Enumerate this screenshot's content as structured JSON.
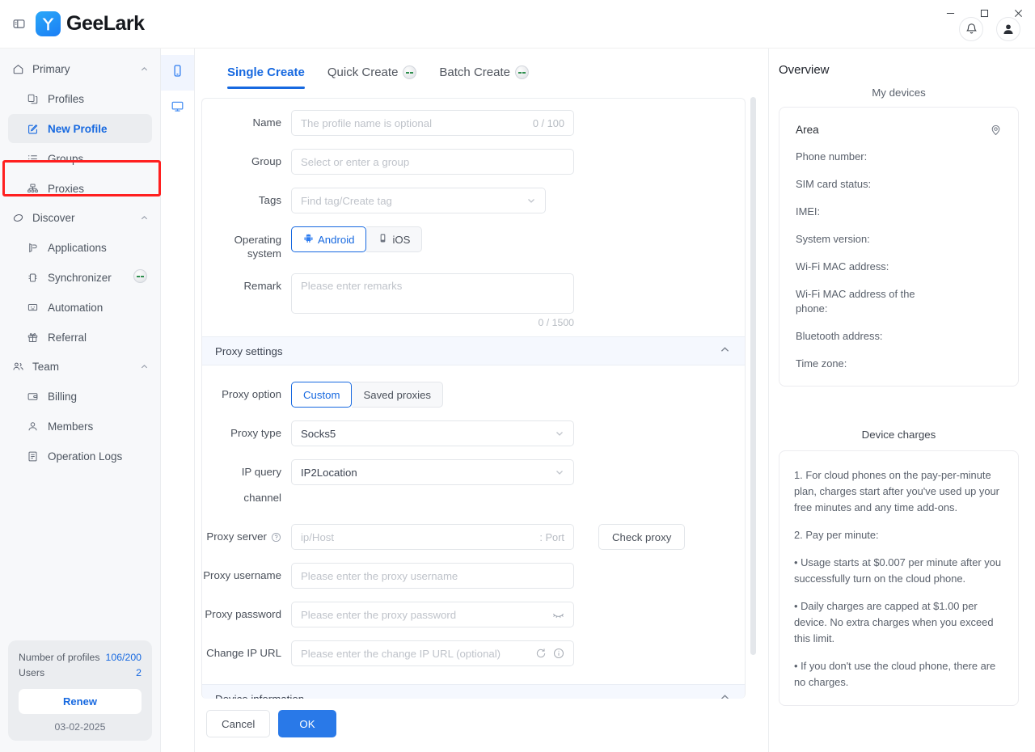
{
  "window": {
    "minimize_label": "Minimize",
    "maximize_label": "Maximize",
    "close_label": "Close"
  },
  "brand": {
    "name": "GeeLark"
  },
  "sidebar": {
    "groups": [
      {
        "label": "Primary",
        "icon": "home-icon",
        "items": [
          {
            "label": "Profiles",
            "icon": "profiles-icon",
            "active": false,
            "badge": false
          },
          {
            "label": "New Profile",
            "icon": "new-profile-icon",
            "active": true,
            "badge": false
          },
          {
            "label": "Groups",
            "icon": "groups-icon",
            "active": false,
            "badge": false
          },
          {
            "label": "Proxies",
            "icon": "proxies-icon",
            "active": false,
            "badge": false
          }
        ]
      },
      {
        "label": "Discover",
        "icon": "discover-icon",
        "items": [
          {
            "label": "Applications",
            "icon": "applications-icon",
            "active": false,
            "badge": false
          },
          {
            "label": "Synchronizer",
            "icon": "synchronizer-icon",
            "active": false,
            "badge": true
          },
          {
            "label": "Automation",
            "icon": "automation-icon",
            "active": false,
            "badge": false
          },
          {
            "label": "Referral",
            "icon": "referral-icon",
            "active": false,
            "badge": false
          }
        ]
      },
      {
        "label": "Team",
        "icon": "team-icon",
        "items": [
          {
            "label": "Billing",
            "icon": "billing-icon",
            "active": false,
            "badge": false
          },
          {
            "label": "Members",
            "icon": "members-icon",
            "active": false,
            "badge": false
          },
          {
            "label": "Operation Logs",
            "icon": "operation-logs-icon",
            "active": false,
            "badge": false
          }
        ]
      }
    ],
    "footer": {
      "profiles_label": "Number of profiles",
      "profiles_value": "106/200",
      "users_label": "Users",
      "users_value": "2",
      "renew_label": "Renew",
      "date": "03-02-2025"
    }
  },
  "rail": {
    "items": [
      {
        "icon": "phone-icon",
        "active": true
      },
      {
        "icon": "desktop-icon",
        "active": false
      }
    ]
  },
  "main": {
    "tabs": [
      {
        "label": "Single Create",
        "active": true,
        "badge": false
      },
      {
        "label": "Quick Create",
        "active": false,
        "badge": true
      },
      {
        "label": "Batch Create",
        "active": false,
        "badge": true
      }
    ],
    "form": {
      "name_label": "Name",
      "name_placeholder": "The profile name is optional",
      "name_counter": "0 / 100",
      "group_label": "Group",
      "group_placeholder": "Select or enter a group",
      "tags_label": "Tags",
      "tags_placeholder": "Find tag/Create tag",
      "os_label": "Operating system",
      "os_options": [
        {
          "label": "Android",
          "selected": true,
          "icon": "android-icon"
        },
        {
          "label": "iOS",
          "selected": false,
          "icon": "ios-icon"
        }
      ],
      "remark_label": "Remark",
      "remark_placeholder": "Please enter remarks",
      "remark_counter": "0 / 1500"
    },
    "proxy_section": {
      "title": "Proxy settings",
      "collapse_icon": "chevron-up-icon",
      "option_label": "Proxy option",
      "options": [
        {
          "label": "Custom",
          "selected": true
        },
        {
          "label": "Saved proxies",
          "selected": false
        }
      ],
      "type_label": "Proxy type",
      "type_value": "Socks5",
      "channel_label": "IP query channel",
      "channel_value": "IP2Location",
      "server_label": "Proxy server",
      "server_help_icon": "question-circle-icon",
      "server_placeholder": "ip/Host",
      "server_port_placeholder": ": Port",
      "check_proxy_label": "Check proxy",
      "username_label": "Proxy username",
      "username_placeholder": "Please enter the proxy username",
      "password_label": "Proxy password",
      "password_placeholder": "Please enter the proxy password",
      "password_toggle_icon": "eye-closed-icon",
      "change_ip_label": "Change IP URL",
      "change_ip_placeholder": "Please enter the change IP URL (optional)",
      "change_ip_refresh_icon": "refresh-icon",
      "change_ip_info_icon": "info-circle-icon"
    },
    "device_section": {
      "title": "Device information",
      "collapse_icon": "chevron-up-icon"
    },
    "footer": {
      "cancel_label": "Cancel",
      "ok_label": "OK"
    }
  },
  "overview": {
    "title": "Overview",
    "devices_subtitle": "My devices",
    "area_label": "Area",
    "location_icon": "location-pin-icon",
    "fields": [
      "Phone number:",
      "SIM card status:",
      "IMEI:",
      "System version:",
      "Wi-Fi MAC address:",
      "Wi-Fi MAC address of the phone:",
      "Bluetooth address:",
      "Time zone:"
    ],
    "charges_title": "Device charges",
    "charges_paragraphs": [
      "1. For cloud phones on the pay-per-minute plan, charges start after you've used up your free minutes and any time add-ons.",
      "2. Pay per minute:",
      "• Usage starts at $0.007 per minute after you successfully turn on the cloud phone.",
      "• Daily charges are capped at $1.00 per device. No extra charges when you exceed this limit.",
      "• If you don't use the cloud phone, there are no charges."
    ]
  },
  "colors": {
    "accent": "#1769e0",
    "primary_button": "#2979e8",
    "highlight_box": "#ff1f1f",
    "sidebar_bg": "#f7f8fa",
    "section_bg": "#f5f8fe"
  }
}
